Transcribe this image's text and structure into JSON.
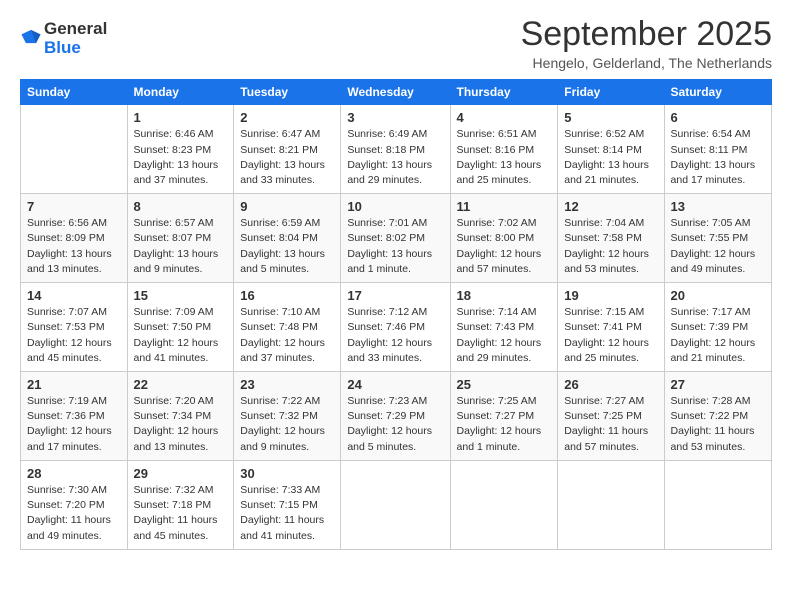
{
  "logo": {
    "general": "General",
    "blue": "Blue"
  },
  "title": "September 2025",
  "subtitle": "Hengelo, Gelderland, The Netherlands",
  "days_of_week": [
    "Sunday",
    "Monday",
    "Tuesday",
    "Wednesday",
    "Thursday",
    "Friday",
    "Saturday"
  ],
  "weeks": [
    [
      {
        "day": "",
        "info": ""
      },
      {
        "day": "1",
        "info": "Sunrise: 6:46 AM\nSunset: 8:23 PM\nDaylight: 13 hours\nand 37 minutes."
      },
      {
        "day": "2",
        "info": "Sunrise: 6:47 AM\nSunset: 8:21 PM\nDaylight: 13 hours\nand 33 minutes."
      },
      {
        "day": "3",
        "info": "Sunrise: 6:49 AM\nSunset: 8:18 PM\nDaylight: 13 hours\nand 29 minutes."
      },
      {
        "day": "4",
        "info": "Sunrise: 6:51 AM\nSunset: 8:16 PM\nDaylight: 13 hours\nand 25 minutes."
      },
      {
        "day": "5",
        "info": "Sunrise: 6:52 AM\nSunset: 8:14 PM\nDaylight: 13 hours\nand 21 minutes."
      },
      {
        "day": "6",
        "info": "Sunrise: 6:54 AM\nSunset: 8:11 PM\nDaylight: 13 hours\nand 17 minutes."
      }
    ],
    [
      {
        "day": "7",
        "info": "Sunrise: 6:56 AM\nSunset: 8:09 PM\nDaylight: 13 hours\nand 13 minutes."
      },
      {
        "day": "8",
        "info": "Sunrise: 6:57 AM\nSunset: 8:07 PM\nDaylight: 13 hours\nand 9 minutes."
      },
      {
        "day": "9",
        "info": "Sunrise: 6:59 AM\nSunset: 8:04 PM\nDaylight: 13 hours\nand 5 minutes."
      },
      {
        "day": "10",
        "info": "Sunrise: 7:01 AM\nSunset: 8:02 PM\nDaylight: 13 hours\nand 1 minute."
      },
      {
        "day": "11",
        "info": "Sunrise: 7:02 AM\nSunset: 8:00 PM\nDaylight: 12 hours\nand 57 minutes."
      },
      {
        "day": "12",
        "info": "Sunrise: 7:04 AM\nSunset: 7:58 PM\nDaylight: 12 hours\nand 53 minutes."
      },
      {
        "day": "13",
        "info": "Sunrise: 7:05 AM\nSunset: 7:55 PM\nDaylight: 12 hours\nand 49 minutes."
      }
    ],
    [
      {
        "day": "14",
        "info": "Sunrise: 7:07 AM\nSunset: 7:53 PM\nDaylight: 12 hours\nand 45 minutes."
      },
      {
        "day": "15",
        "info": "Sunrise: 7:09 AM\nSunset: 7:50 PM\nDaylight: 12 hours\nand 41 minutes."
      },
      {
        "day": "16",
        "info": "Sunrise: 7:10 AM\nSunset: 7:48 PM\nDaylight: 12 hours\nand 37 minutes."
      },
      {
        "day": "17",
        "info": "Sunrise: 7:12 AM\nSunset: 7:46 PM\nDaylight: 12 hours\nand 33 minutes."
      },
      {
        "day": "18",
        "info": "Sunrise: 7:14 AM\nSunset: 7:43 PM\nDaylight: 12 hours\nand 29 minutes."
      },
      {
        "day": "19",
        "info": "Sunrise: 7:15 AM\nSunset: 7:41 PM\nDaylight: 12 hours\nand 25 minutes."
      },
      {
        "day": "20",
        "info": "Sunrise: 7:17 AM\nSunset: 7:39 PM\nDaylight: 12 hours\nand 21 minutes."
      }
    ],
    [
      {
        "day": "21",
        "info": "Sunrise: 7:19 AM\nSunset: 7:36 PM\nDaylight: 12 hours\nand 17 minutes."
      },
      {
        "day": "22",
        "info": "Sunrise: 7:20 AM\nSunset: 7:34 PM\nDaylight: 12 hours\nand 13 minutes."
      },
      {
        "day": "23",
        "info": "Sunrise: 7:22 AM\nSunset: 7:32 PM\nDaylight: 12 hours\nand 9 minutes."
      },
      {
        "day": "24",
        "info": "Sunrise: 7:23 AM\nSunset: 7:29 PM\nDaylight: 12 hours\nand 5 minutes."
      },
      {
        "day": "25",
        "info": "Sunrise: 7:25 AM\nSunset: 7:27 PM\nDaylight: 12 hours\nand 1 minute."
      },
      {
        "day": "26",
        "info": "Sunrise: 7:27 AM\nSunset: 7:25 PM\nDaylight: 11 hours\nand 57 minutes."
      },
      {
        "day": "27",
        "info": "Sunrise: 7:28 AM\nSunset: 7:22 PM\nDaylight: 11 hours\nand 53 minutes."
      }
    ],
    [
      {
        "day": "28",
        "info": "Sunrise: 7:30 AM\nSunset: 7:20 PM\nDaylight: 11 hours\nand 49 minutes."
      },
      {
        "day": "29",
        "info": "Sunrise: 7:32 AM\nSunset: 7:18 PM\nDaylight: 11 hours\nand 45 minutes."
      },
      {
        "day": "30",
        "info": "Sunrise: 7:33 AM\nSunset: 7:15 PM\nDaylight: 11 hours\nand 41 minutes."
      },
      {
        "day": "",
        "info": ""
      },
      {
        "day": "",
        "info": ""
      },
      {
        "day": "",
        "info": ""
      },
      {
        "day": "",
        "info": ""
      }
    ]
  ]
}
